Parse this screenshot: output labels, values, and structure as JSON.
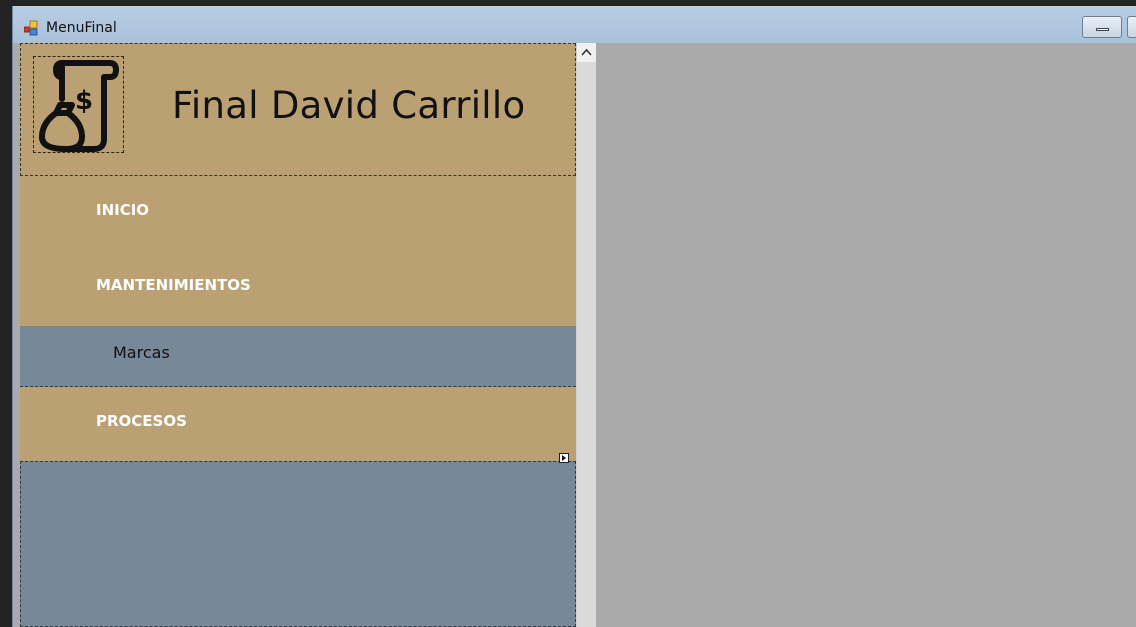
{
  "window": {
    "title": "MenuFinal"
  },
  "header": {
    "brand_title": "Final David Carrillo",
    "logo_icon": "scroll-money-bag-icon"
  },
  "menu": {
    "items": [
      {
        "label": "INICIO"
      },
      {
        "label": "MANTENIMIENTOS"
      },
      {
        "label": "PROCESOS"
      }
    ],
    "submenu_mantenimientos": [
      {
        "label": "Marcas"
      }
    ]
  },
  "colors": {
    "menu_background": "#bba073",
    "submenu_background": "#778899",
    "content_background": "#aaaaaa",
    "menu_text": "#ffffff"
  }
}
